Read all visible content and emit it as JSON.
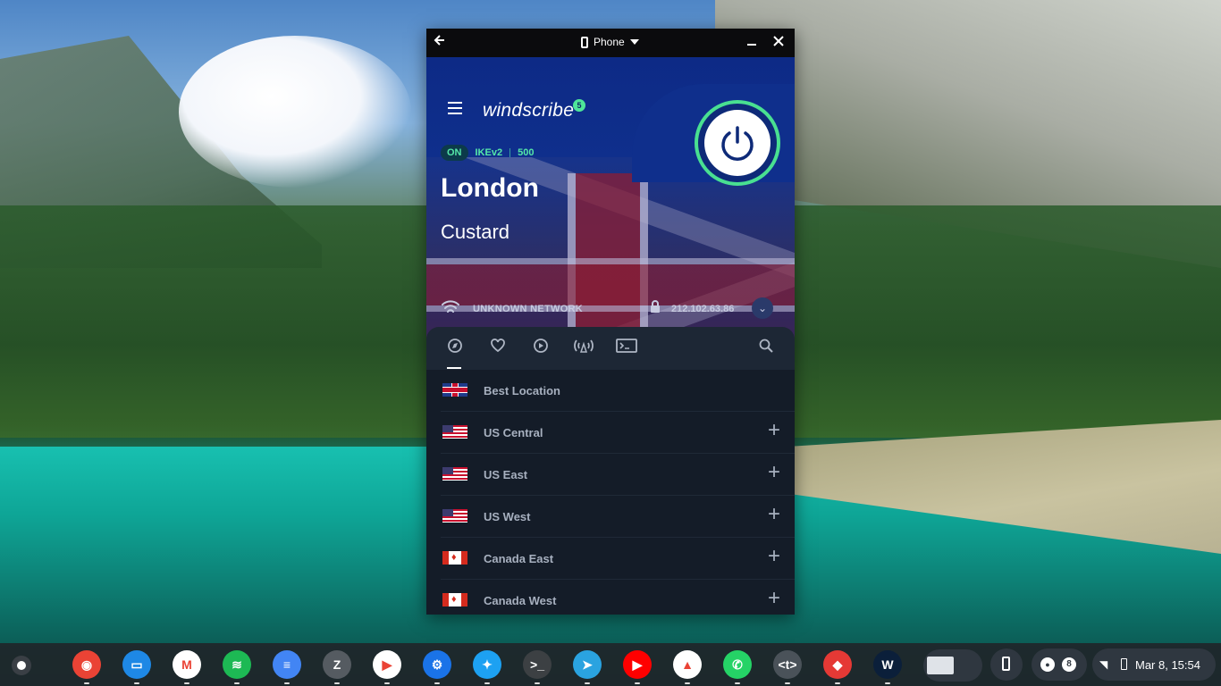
{
  "window": {
    "title_mode": "Phone",
    "icons": [
      "back-arrow-icon",
      "phone-icon",
      "dropdown-caret-icon",
      "minimize-icon",
      "close-icon"
    ]
  },
  "app": {
    "brand": "windscribe",
    "badge_count": "5",
    "status": {
      "state": "ON",
      "protocol": "IKEv2",
      "port": "500"
    },
    "location": {
      "city": "London",
      "nickname": "Custard"
    },
    "network": {
      "name": "UNKNOWN NETWORK",
      "ip": "212.102.63.86"
    },
    "accent_color": "#55e7a8",
    "tabs": [
      "compass-icon",
      "heart-icon",
      "play-icon",
      "broadcast-icon",
      "terminal-icon",
      "search-icon"
    ],
    "locations": [
      {
        "label": "Best Location",
        "flag": "uk",
        "expandable": false
      },
      {
        "label": "US Central",
        "flag": "us",
        "expandable": true
      },
      {
        "label": "US East",
        "flag": "us",
        "expandable": true
      },
      {
        "label": "US West",
        "flag": "us",
        "expandable": true
      },
      {
        "label": "Canada East",
        "flag": "ca",
        "expandable": true
      },
      {
        "label": "Canada West",
        "flag": "ca",
        "expandable": true
      }
    ]
  },
  "shelf": {
    "apps": [
      {
        "name": "Chrome",
        "icon": "chrome-icon",
        "color": "#ea4335",
        "glyph": "◉"
      },
      {
        "name": "Files",
        "icon": "files-icon",
        "color": "#1e88e5",
        "glyph": "▭"
      },
      {
        "name": "Gmail",
        "icon": "gmail-icon",
        "color": "#ffffff",
        "glyph": "M"
      },
      {
        "name": "Spotify",
        "icon": "spotify-icon",
        "color": "#1db954",
        "glyph": "≋"
      },
      {
        "name": "Docs",
        "icon": "docs-icon",
        "color": "#4285f4",
        "glyph": "≡"
      },
      {
        "name": "Z",
        "icon": "z-app-icon",
        "color": "#555b61",
        "glyph": "Z"
      },
      {
        "name": "Play Store",
        "icon": "play-store-icon",
        "color": "#ffffff",
        "glyph": "▶"
      },
      {
        "name": "Settings",
        "icon": "settings-icon",
        "color": "#1a73e8",
        "glyph": "⚙"
      },
      {
        "name": "Twitter",
        "icon": "twitter-icon",
        "color": "#1da1f2",
        "glyph": "✦"
      },
      {
        "name": "Terminal",
        "icon": "terminal-app-icon",
        "color": "#3c4043",
        "glyph": ">_"
      },
      {
        "name": "Telegram",
        "icon": "telegram-icon",
        "color": "#2aa3e0",
        "glyph": "➤"
      },
      {
        "name": "YouTube",
        "icon": "youtube-icon",
        "color": "#ff0000",
        "glyph": "▶"
      },
      {
        "name": "Drive",
        "icon": "drive-icon",
        "color": "#ffffff",
        "glyph": "▲"
      },
      {
        "name": "WhatsApp",
        "icon": "whatsapp-icon",
        "color": "#25d366",
        "glyph": "✆"
      },
      {
        "name": "Dev",
        "icon": "code-app-icon",
        "color": "#4a5259",
        "glyph": "<t>"
      },
      {
        "name": "Pixel",
        "icon": "pixel-app-icon",
        "color": "#e53935",
        "glyph": "◆"
      },
      {
        "name": "Windscribe",
        "icon": "windscribe-app-icon",
        "color": "#0b1f3a",
        "glyph": "W"
      }
    ],
    "tray": {
      "badge_a": "",
      "badge_b": "8",
      "clock": "Mar 8, 15:54"
    }
  }
}
